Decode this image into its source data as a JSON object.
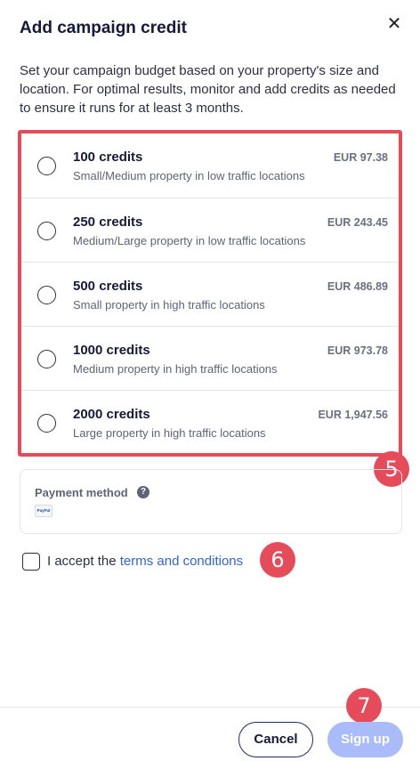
{
  "dialog": {
    "title": "Add campaign credit",
    "close_icon": "close-icon",
    "description": "Set your campaign budget based on your property's size and location. For optimal results, monitor and add credits as needed to ensure it runs for at least 3 months."
  },
  "options": [
    {
      "title": "100 credits",
      "subtitle": "Small/Medium property in low traffic locations",
      "price": "EUR 97.38",
      "selected": false
    },
    {
      "title": "250 credits",
      "subtitle": "Medium/Large property in low traffic locations",
      "price": "EUR 243.45",
      "selected": false
    },
    {
      "title": "500 credits",
      "subtitle": "Small property in high traffic locations",
      "price": "EUR 486.89",
      "selected": false
    },
    {
      "title": "1000 credits",
      "subtitle": "Medium property in high traffic locations",
      "price": "EUR 973.78",
      "selected": false
    },
    {
      "title": "2000 credits",
      "subtitle": "Large property in high traffic locations",
      "price": "EUR 1,947.56",
      "selected": false
    }
  ],
  "payment": {
    "label": "Payment method",
    "help_icon": "question-circle-icon",
    "method_logo": "PayPal"
  },
  "terms": {
    "prefix": "I accept the ",
    "link": "terms and conditions",
    "checked": false
  },
  "footer": {
    "cancel_label": "Cancel",
    "signup_label": "Sign up"
  },
  "annotations": {
    "badge_5": "5",
    "badge_6": "6",
    "badge_7": "7"
  },
  "colors": {
    "accent_red": "#e64b59",
    "link_blue": "#2f63d8",
    "signup_disabled": "#a9bcf9",
    "navy": "#1c2a6b"
  }
}
